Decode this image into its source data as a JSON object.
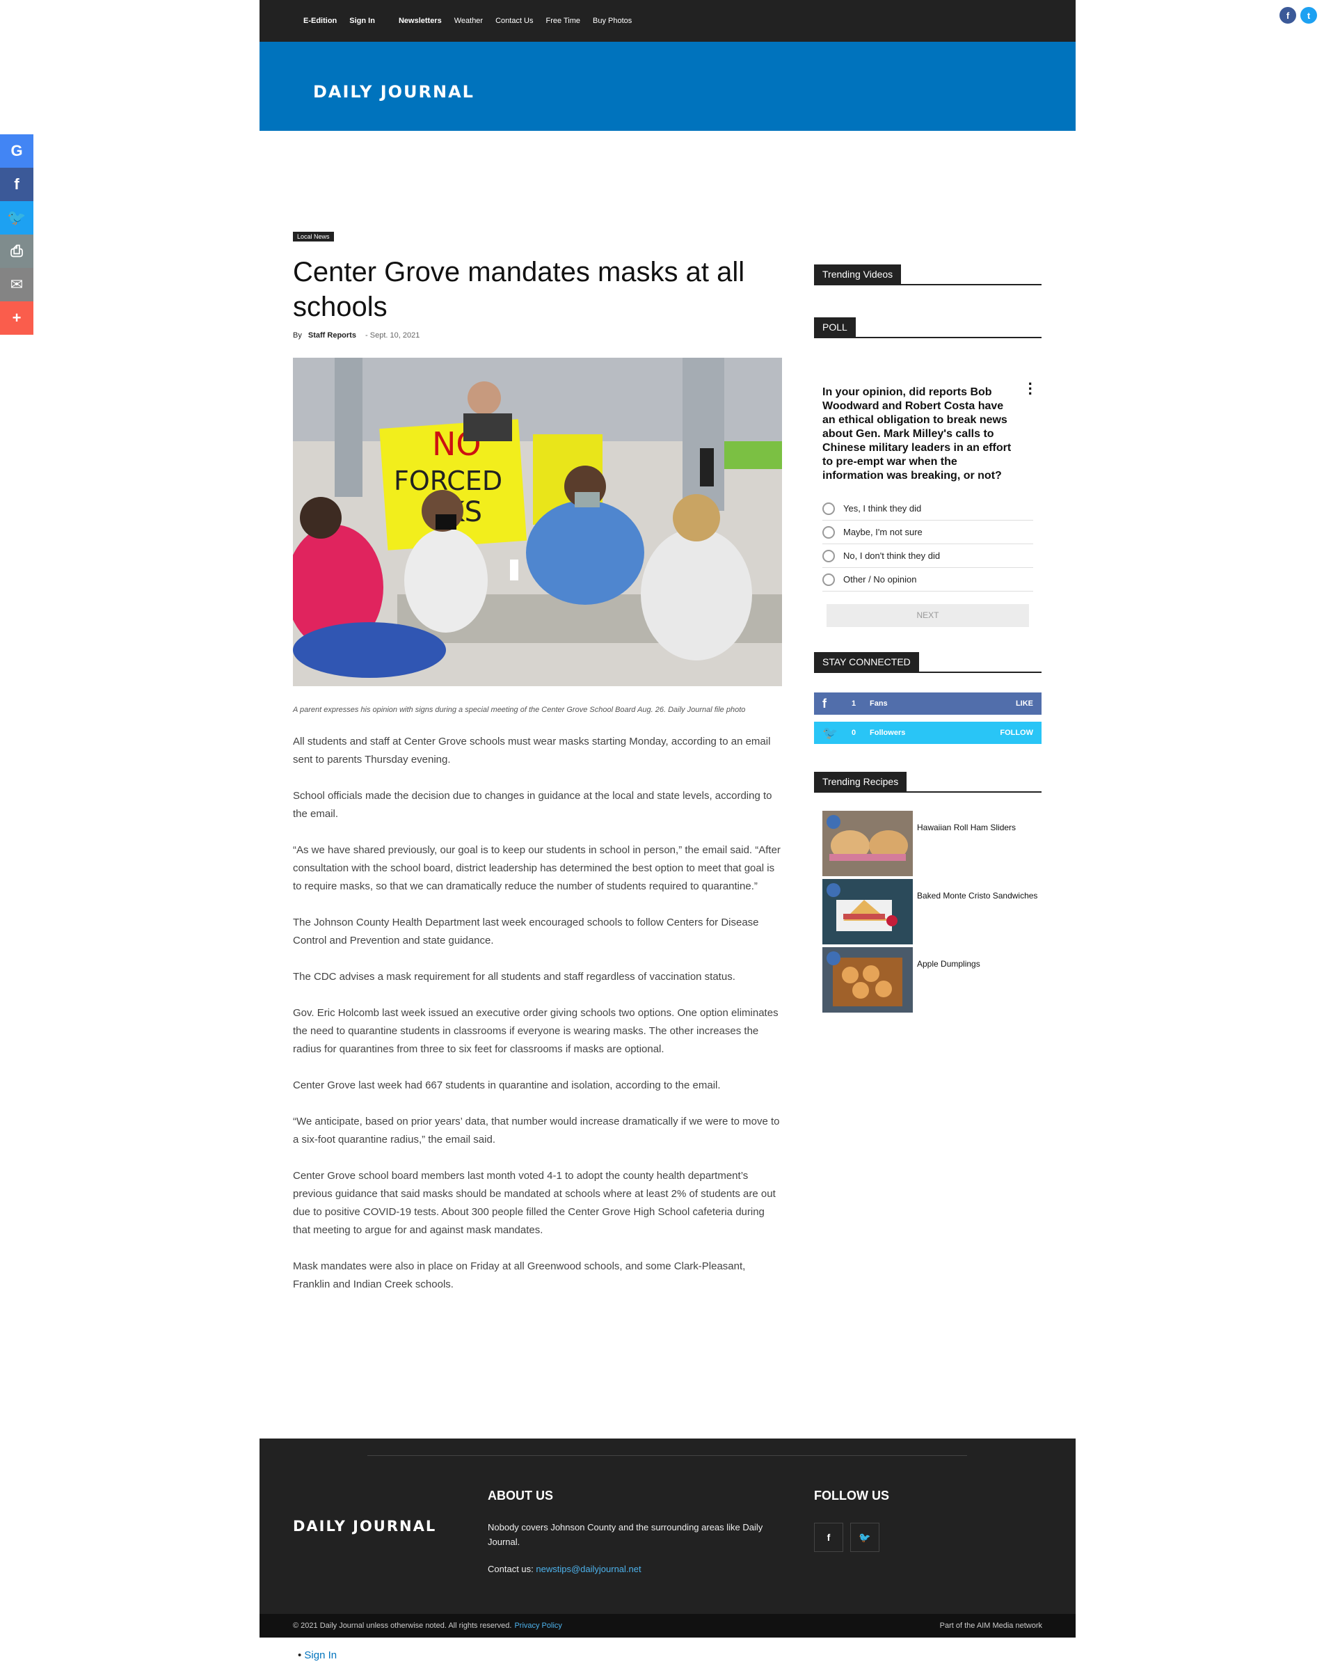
{
  "share_bar": [
    {
      "name": "google-share-button",
      "glyph": "G"
    },
    {
      "name": "facebook-share-button",
      "glyph": "f"
    },
    {
      "name": "twitter-share-button",
      "glyph": "🐦"
    },
    {
      "name": "print-share-button",
      "glyph": "⎙"
    },
    {
      "name": "email-share-button",
      "glyph": "✉"
    },
    {
      "name": "more-share-button",
      "glyph": "+"
    }
  ],
  "top_social": {
    "facebook": "f",
    "twitter": "t"
  },
  "nav": {
    "e_edition": "E-Edition",
    "sign_in": "Sign In",
    "newsletters": "Newsletters",
    "weather": "Weather",
    "contact_us": "Contact Us",
    "free_time": "Free Time",
    "buy_photos": "Buy Photos"
  },
  "brand": {
    "logo": "DAILY JOURNAL"
  },
  "article": {
    "category": "Local News",
    "title": "Center Grove mandates masks at all schools",
    "by": "By",
    "author": "Staff Reports",
    "date": "Sept. 10, 2021",
    "hero_sign_text": "NO FORCED MASKS",
    "caption": "A parent expresses his opinion with signs during a special meeting of the Center Grove School Board Aug. 26. Daily Journal file photo",
    "paragraphs": [
      "All students and staff at Center Grove schools must wear masks starting Monday, according to an email sent to parents Thursday evening.",
      "School officials made the decision due to changes in guidance at the local and state levels, according to the email.",
      "“As we have shared previously, our goal is to keep our students in school in person,” the email said. “After consultation with the school board, district leadership has determined the best option to meet that goal is to require masks, so that we can dramatically reduce the number of students required to quarantine.”",
      "The Johnson County Health Department last week encouraged schools to follow Centers for Disease Control and Prevention and state guidance.",
      "The CDC advises a mask requirement for all students and staff regardless of vaccination status.",
      "Gov. Eric Holcomb last week issued an executive order giving schools two options. One option eliminates the need to quarantine students in classrooms if everyone is wearing masks. The other increases the radius for quarantines from three to six feet for classrooms if masks are optional.",
      "Center Grove last week had 667 students in quarantine and isolation, according to the email.",
      "“We anticipate, based on prior years’ data, that number would increase dramatically if we were to move to a six-foot quarantine radius,” the email said.",
      "Center Grove school board members last month voted 4-1 to adopt the county health department’s previous guidance that said masks should be mandated at schools where at least 2% of students are out due to positive COVID-19 tests. About 300 people filled the Center Grove High School cafeteria during that meeting to argue for and against mask mandates.",
      "Mask mandates were also in place on Friday at all Greenwood schools, and some Clark-Pleasant, Franklin and Indian Creek schools."
    ]
  },
  "sidebar": {
    "trending_videos": "Trending Videos",
    "poll_title": "POLL",
    "poll_question": "In your opinion, did reports Bob Woodward and Robert Costa have an ethical obligation to break news about Gen. Mark Milley's calls to Chinese military leaders in an effort to pre-empt war when the information was breaking, or not?",
    "poll_options": [
      "Yes, I think they did",
      "Maybe, I'm not sure",
      "No, I don't think they did",
      "Other / No opinion"
    ],
    "poll_next": "NEXT",
    "stay_connected": "STAY CONNECTED",
    "facebook": {
      "count": "1",
      "label": "Fans",
      "action": "LIKE"
    },
    "twitter": {
      "count": "0",
      "label": "Followers",
      "action": "FOLLOW"
    },
    "trending_recipes": "Trending Recipes",
    "recipes": [
      "Hawaiian Roll Ham Sliders",
      "Baked Monte Cristo Sandwiches",
      "Apple Dumplings"
    ]
  },
  "footer": {
    "logo": "DAILY JOURNAL",
    "about_title": "ABOUT US",
    "about_text": "Nobody covers Johnson County and the surrounding areas like Daily Journal.",
    "contact_label": "Contact us:",
    "contact_email": "newstips@dailyjournal.net",
    "follow_title": "FOLLOW US",
    "follow_fb": "f",
    "follow_tw": "🐦",
    "copyright": "© 2021 Daily Journal unless otherwise noted. All rights reserved.",
    "privacy": "Privacy Policy",
    "network": "Part of the AIM Media network"
  },
  "bottom_sign_in": "Sign In"
}
